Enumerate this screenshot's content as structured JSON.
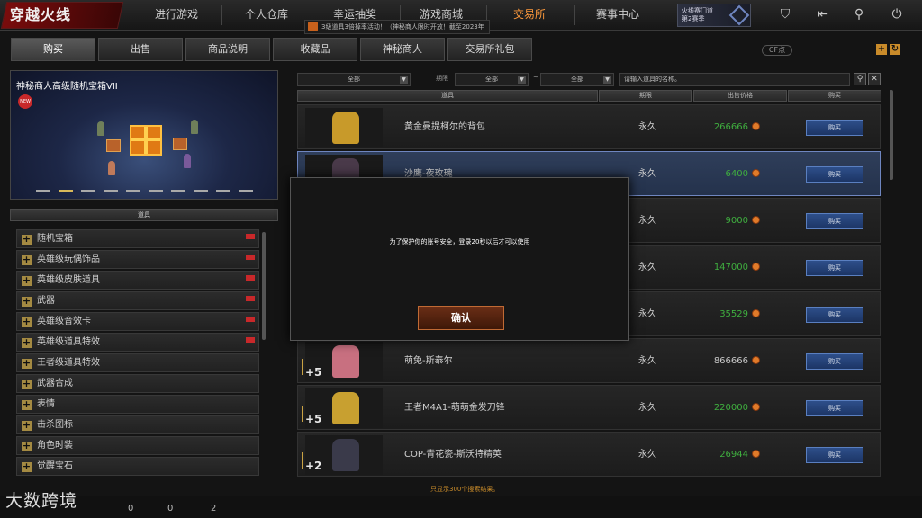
{
  "header": {
    "logo_text": "穿越火线",
    "nav": [
      "进行游戏",
      "个人仓库",
      "幸运抽奖",
      "游戏商城",
      "交易所",
      "赛事中心"
    ],
    "active_nav": "交易所",
    "ticker": "3级道具3倍掉率活动！（神秘商人限时开放！截至2023年",
    "promo_line1": "火线赛门道",
    "promo_line2": "第2赛季",
    "icons": [
      "shield-icon",
      "exit-icon",
      "wrench-icon",
      "power-icon"
    ]
  },
  "tabs": [
    "购买",
    "出售",
    "商品说明",
    "收藏品",
    "神秘商人",
    "交易所礼包"
  ],
  "active_tab": "购买",
  "cf_points_label": "CF点",
  "banner": {
    "title": "神秘商人高级随机宝箱VII",
    "badge": "NEW",
    "page_count": 10,
    "active_page": 2
  },
  "left_panel": {
    "header": "道具",
    "categories": [
      "随机宝箱",
      "英雄级玩偶饰品",
      "英雄级皮肤道具",
      "武器",
      "英雄级音效卡",
      "英雄级道具特效",
      "王者级道具特效",
      "武器合成",
      "表情",
      "击杀图标",
      "角色时装",
      "觉醒宝石"
    ]
  },
  "filters": {
    "type_select": "全部",
    "period_label": "期限",
    "period_from": "全部",
    "period_sep": "~",
    "period_to": "全部",
    "search_placeholder": "请输入道具的名称。"
  },
  "table": {
    "columns": [
      "道具",
      "期限",
      "出售价格",
      "购买"
    ],
    "rows": [
      {
        "name": "黄金曼提柯尔的背包",
        "duration": "永久",
        "price": "266666",
        "buy": "购买",
        "plus": "",
        "color": "#c89a2a",
        "highlight": false,
        "price_color": "green"
      },
      {
        "name": "沙鹰-夜玫瑰",
        "duration": "永久",
        "price": "6400",
        "buy": "购买",
        "plus": "",
        "color": "#4a3a4a",
        "highlight": true,
        "price_color": "green"
      },
      {
        "name": "",
        "duration": "永久",
        "price": "9000",
        "buy": "购买",
        "plus": "",
        "color": "#2a3a2a",
        "highlight": false,
        "price_color": "green"
      },
      {
        "name": "",
        "duration": "永久",
        "price": "147000",
        "buy": "购买",
        "plus": "",
        "color": "#3a3a2a",
        "highlight": false,
        "price_color": "green"
      },
      {
        "name": "",
        "duration": "永久",
        "price": "35529",
        "buy": "购买",
        "plus": "",
        "color": "#2a2a3a",
        "highlight": false,
        "price_color": "green"
      },
      {
        "name": "萌兔-斯泰尔",
        "duration": "永久",
        "price": "866666",
        "buy": "购买",
        "plus": "+5",
        "color": "#c87080",
        "highlight": false,
        "price_color": "white"
      },
      {
        "name": "王者M4A1-萌萌金发刀锋",
        "duration": "永久",
        "price": "220000",
        "buy": "购买",
        "plus": "+5",
        "color": "#c8a030",
        "highlight": false,
        "price_color": "green"
      },
      {
        "name": "COP-青花瓷-斯沃特精英",
        "duration": "永久",
        "price": "26944",
        "buy": "购买",
        "plus": "+2",
        "color": "#3a3a4a",
        "highlight": false,
        "price_color": "green"
      }
    ],
    "footnote": "只显示300个搜索结果。"
  },
  "modal": {
    "message": "为了保护你的账号安全，登录20秒以后才可以使用",
    "confirm_label": "确认"
  },
  "bottom": {
    "watermark": "大数跨境",
    "count1": "0",
    "count2": "0",
    "count3": "2"
  }
}
